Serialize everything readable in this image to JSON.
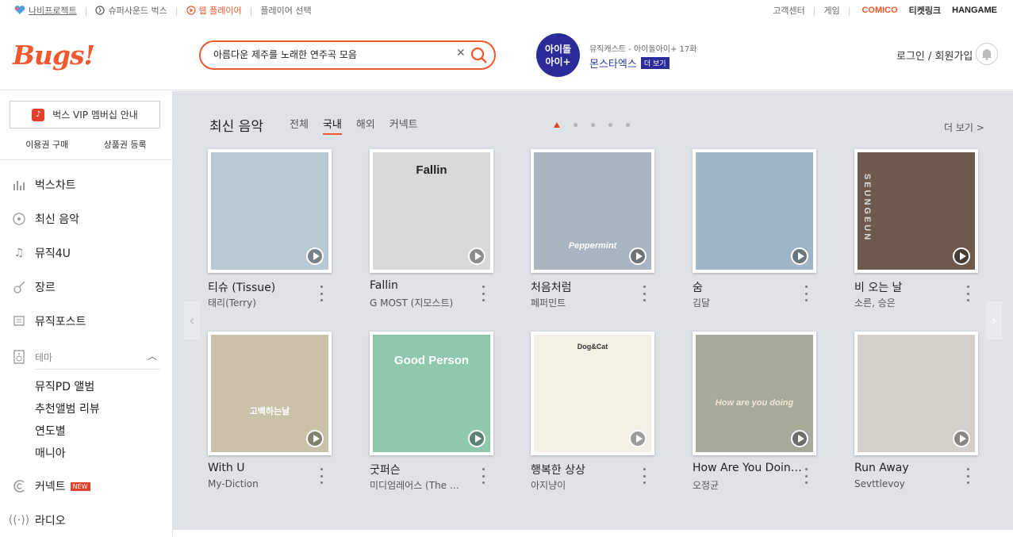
{
  "topbar": {
    "left": [
      "나비프로젝트",
      "슈퍼사운드 벅스",
      "웹 플레이어",
      "플레이어 선택"
    ],
    "right": [
      "고객센터",
      "게임"
    ],
    "brands": [
      "COMICO",
      "티켓링크",
      "HANGAME"
    ]
  },
  "header": {
    "logo": "Bugs!",
    "search_value": "아름다운 제주를 노래한 연주곡 모음",
    "podcast_thumb": [
      "아이돌",
      "아이+"
    ],
    "podcast_sub": "뮤직캐스트 - 아이돌아이+ 17화",
    "podcast_title": "몬스타엑스",
    "podcast_more": "더 보기",
    "login": "로그인 / 회원가입"
  },
  "sidebar": {
    "vip": "벅스 VIP 멤버십 안내",
    "buy": "이용권 구매",
    "register": "상품권 등록",
    "nav": [
      "벅스차트",
      "최신 음악",
      "뮤직4U",
      "장르",
      "뮤직포스트"
    ],
    "theme": "테마",
    "theme_items": [
      "뮤직PD 앨범",
      "추천앨범 리뷰",
      "연도별",
      "매니아"
    ],
    "connect": "커넥트",
    "new_badge": "NEW",
    "radio": "라디오"
  },
  "main": {
    "title": "최신 음악",
    "tabs": [
      "전체",
      "국내",
      "해외",
      "커넥트"
    ],
    "see_more": "더 보기 >",
    "albums": [
      {
        "title": "티슈 (Tissue)",
        "artist": "태리(Terry)",
        "color": "#b9c9d3"
      },
      {
        "title": "Fallin",
        "artist": "G MOST (지모스트)",
        "color": "#d9d9d9",
        "art_text": "Fallin"
      },
      {
        "title": "처음처럼",
        "artist": "페퍼민트",
        "color": "#a8b4bf",
        "art_text": "Peppermint"
      },
      {
        "title": "숨",
        "artist": "김달",
        "color": "#9fb4c4"
      },
      {
        "title": "비 오는 날",
        "artist": "소른, 승은",
        "color": "#6d5a4c",
        "art_text": "SEUNGEUN"
      },
      {
        "title": "With U",
        "artist": "My-Diction",
        "color": "#c9c2a8",
        "art_text": "고백하는날"
      },
      {
        "title": "굿퍼슨",
        "artist": "미디엄레어스 (The …",
        "color": "#8ec9ab",
        "art_text": "Good Person"
      },
      {
        "title": "행복한 상상",
        "artist": "아지냥이",
        "color": "#f3f0e6",
        "art_text": "Dog&Cat"
      },
      {
        "title": "How Are You Doing?",
        "artist": "오정균",
        "color": "#a5aa9a",
        "art_text": "How are you doing"
      },
      {
        "title": "Run Away",
        "artist": "Sevttlevoy",
        "color": "#d4cfc8"
      }
    ]
  }
}
